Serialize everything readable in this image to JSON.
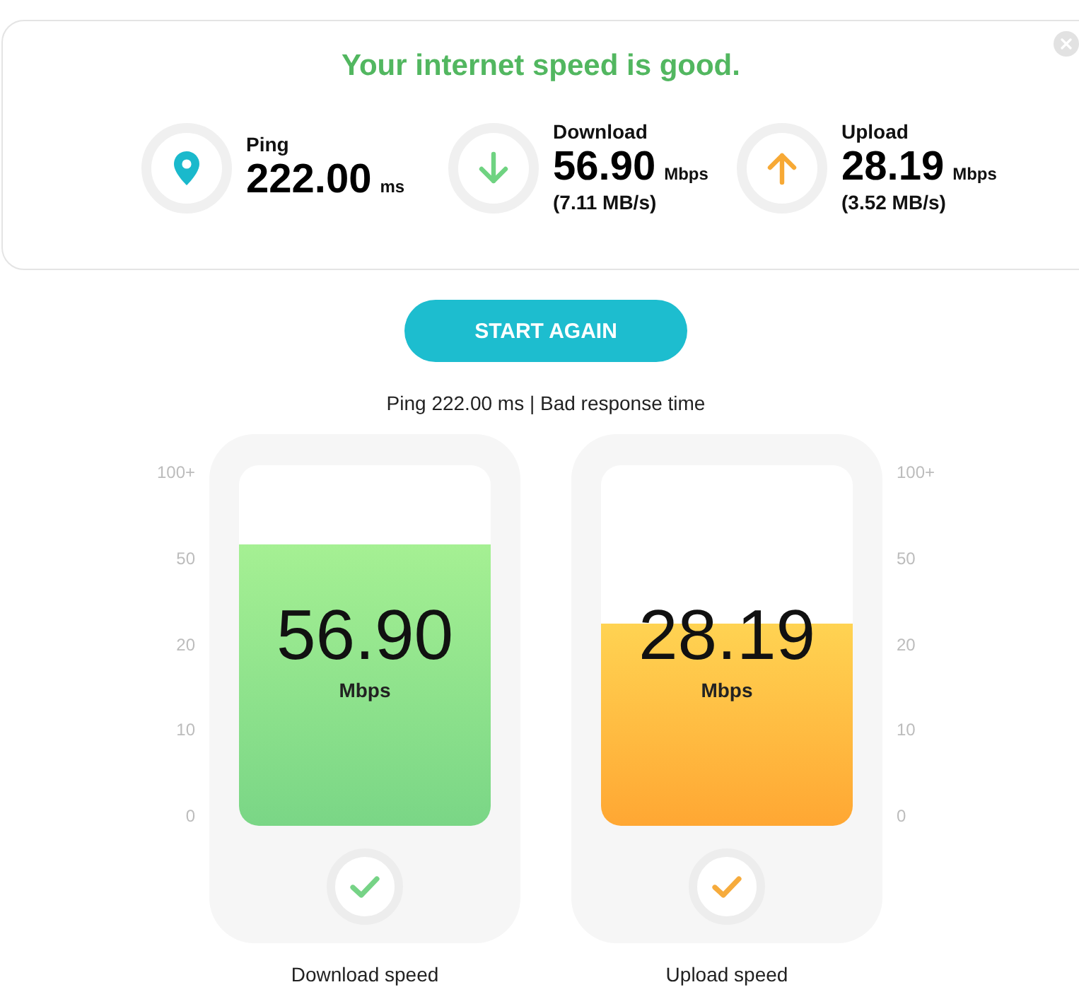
{
  "result": {
    "title": "Your internet speed is good.",
    "stats": [
      {
        "kind": "ping",
        "label": "Ping",
        "value": "222.00",
        "unit": "ms"
      },
      {
        "kind": "download",
        "label": "Download",
        "value": "56.90",
        "unit": "Mbps",
        "rate": "(7.11 MB/s)"
      },
      {
        "kind": "upload",
        "label": "Upload",
        "value": "28.19",
        "unit": "Mbps",
        "rate": "(3.52 MB/s)"
      }
    ]
  },
  "action_button": "START AGAIN",
  "ping_summary": "Ping 222.00 ms | Bad response time",
  "gauges": [
    {
      "kind": "download",
      "value": "56.90",
      "unit": "Mbps",
      "level": 0.78,
      "scale": [
        "100+",
        "50",
        "20",
        "10",
        "0"
      ],
      "complete": true,
      "caption": "Download speed"
    },
    {
      "kind": "upload",
      "value": "28.19",
      "unit": "Mbps",
      "level": 0.56,
      "scale": [
        "100+",
        "50",
        "20",
        "10",
        "0"
      ],
      "complete": true,
      "caption": "Upload speed"
    }
  ]
}
